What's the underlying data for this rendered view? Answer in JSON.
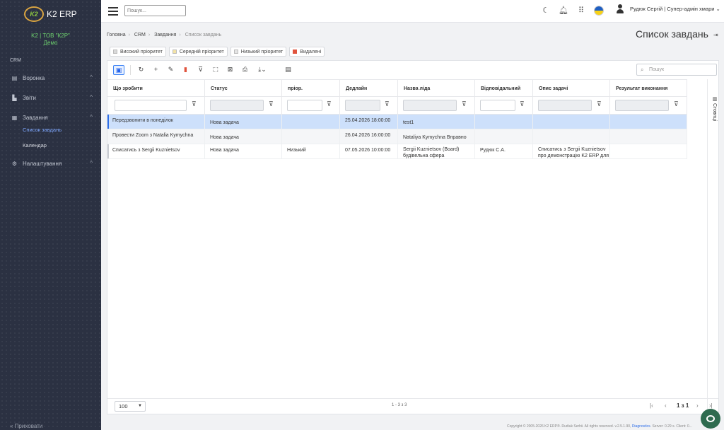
{
  "app": {
    "name": "K2 ERP",
    "logo_mark": "K2"
  },
  "company": {
    "line1": "K2 | ТОВ \"К2Р\"",
    "line2": "Демо"
  },
  "sidebar": {
    "section": "CRM",
    "items": [
      {
        "label": "Воронка",
        "icon": "document-icon"
      },
      {
        "label": "Звіти",
        "icon": "chart-icon"
      },
      {
        "label": "Завдання",
        "icon": "calendar-icon"
      }
    ],
    "subitems": [
      "Список завдань",
      "Календар"
    ],
    "settings": "Налаштування",
    "footer": "« Приховати"
  },
  "topbar": {
    "search_placeholder": "Пошук...",
    "user": "Рудюк Сергій | Супер-адмін хмари"
  },
  "breadcrumb": [
    "Головна",
    "CRM",
    "Завдання",
    "Список завдань"
  ],
  "page_title": "Список завдань",
  "chips": [
    "Високий пріоритет",
    "Середній пріоритет",
    "Низький пріоритет",
    "Видалені"
  ],
  "chip_colors": [
    "#d9d9d9",
    "#f3e3a6",
    "#e5e5e5",
    "#e0533d"
  ],
  "grid": {
    "search_placeholder": "Пошук",
    "columns": [
      "Що зробити",
      "Статус",
      "пріор.",
      "Дедлайн",
      "Назва ліда",
      "Відповідальний",
      "Опис задачі",
      "Результат виконання"
    ],
    "rows": [
      {
        "todo": "Передзвонити в понеділок",
        "status": "Нова задача",
        "priority": "",
        "deadline": "25.04.2026 18:00:00",
        "lead": "test1",
        "owner": "",
        "desc": "",
        "result": ""
      },
      {
        "todo": "Провести Zoom з Natalia Kymychna",
        "status": "Нова задача",
        "priority": "",
        "deadline": "26.04.2026 16:00:00",
        "lead": "Nataliya Kymychna Вправно",
        "owner": "",
        "desc": "",
        "result": ""
      },
      {
        "todo": "Списатись з Sergii Kuznietsov",
        "status": "Нова задача",
        "priority": "Низький",
        "deadline": "07.05.2026 10:00:00",
        "lead": "Sergii Kuznietsov (Board) будівельна сфера",
        "owner": "Рудюк С.А.",
        "desc": "Списатись з Sergii Kuznietsov про демонстрацію K2 ERP для",
        "result": ""
      }
    ],
    "side_tab": "Стовпці"
  },
  "pager": {
    "page_size": "100",
    "info": "1 - 3 з 3",
    "current": "1 з 1"
  },
  "footer": {
    "text": "Copyright © 2005-2026 K2 ERP®. Rudiuk Serhii. All rights reserved. v.2.5.1.90,",
    "link": "Diagnostics",
    "tail": ". Server: 0.29 s. Client: 0..."
  }
}
